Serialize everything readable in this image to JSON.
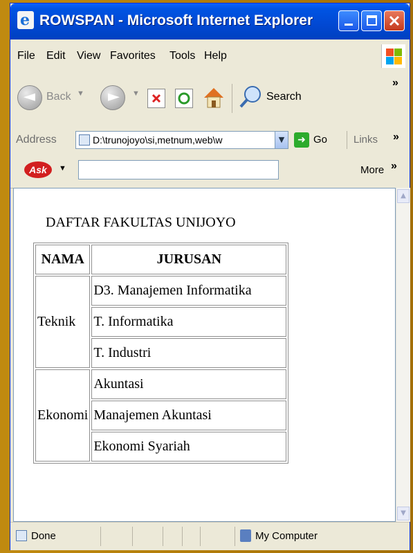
{
  "window": {
    "title": "ROWSPAN - Microsoft Internet Explorer"
  },
  "menu": [
    "File",
    "Edit",
    "View",
    "Favorites",
    "Tools",
    "Help"
  ],
  "toolbar": {
    "back_label": "Back",
    "search_label": "Search",
    "chevron": "»"
  },
  "address": {
    "label": "Address",
    "value": "D:\\trunojoyo\\si,metnum,web\\w",
    "go_label": "Go",
    "links_label": "Links",
    "chevron": "»"
  },
  "askbar": {
    "logo": "Ask",
    "more_label": "More",
    "more_chevron": "»"
  },
  "page": {
    "heading": "DAFTAR FAKULTAS UNIJOYO",
    "table": {
      "headers": [
        "NAMA",
        "JURUSAN"
      ],
      "groups": [
        {
          "nama": "Teknik",
          "jurusan": [
            "D3. Manajemen Informatika",
            "T. Informatika",
            "T. Industri"
          ]
        },
        {
          "nama": "Ekonomi",
          "jurusan": [
            "Akuntasi",
            "Manajemen Akuntasi",
            "Ekonomi Syariah"
          ]
        }
      ]
    }
  },
  "status": {
    "left": "Done",
    "zone": "My Computer"
  },
  "icons": [
    "ie-icon",
    "minimize-icon",
    "maximize-icon",
    "close-icon",
    "windows-flag-icon",
    "back-arrow-icon",
    "forward-arrow-icon",
    "stop-icon",
    "refresh-icon",
    "home-icon",
    "search-icon",
    "go-arrow-icon",
    "page-icon",
    "computer-icon"
  ]
}
